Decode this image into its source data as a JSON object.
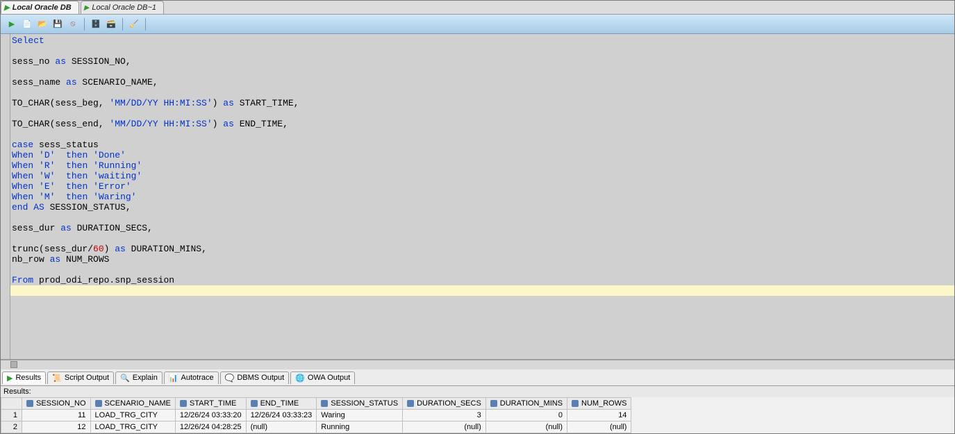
{
  "tabs": [
    {
      "label": "Local Oracle DB",
      "active": true
    },
    {
      "label": "Local Oracle DB~1",
      "active": false
    }
  ],
  "toolbar": {
    "run": "run",
    "new": "new",
    "open": "open",
    "save": "save",
    "cancel": "cancel",
    "commit": "commit",
    "rollback": "rollback",
    "clear": "clear"
  },
  "sql": {
    "lines": [
      {
        "t": "kw",
        "text": "Select"
      },
      {
        "t": "",
        "text": ""
      },
      {
        "t": "mixed",
        "parts": [
          [
            "",
            "sess_no "
          ],
          [
            "kw",
            "as"
          ],
          [
            "",
            " SESSION_NO,"
          ]
        ]
      },
      {
        "t": "",
        "text": ""
      },
      {
        "t": "mixed",
        "parts": [
          [
            "",
            "sess_name "
          ],
          [
            "kw",
            "as"
          ],
          [
            "",
            " SCENARIO_NAME,"
          ]
        ]
      },
      {
        "t": "",
        "text": ""
      },
      {
        "t": "mixed",
        "parts": [
          [
            "",
            "TO_CHAR(sess_beg, "
          ],
          [
            "str",
            "'MM/DD/YY HH:MI:SS'"
          ],
          [
            "",
            ") "
          ],
          [
            "kw",
            "as"
          ],
          [
            "",
            " START_TIME,"
          ]
        ]
      },
      {
        "t": "",
        "text": ""
      },
      {
        "t": "mixed",
        "parts": [
          [
            "",
            "TO_CHAR(sess_end, "
          ],
          [
            "str",
            "'MM/DD/YY HH:MI:SS'"
          ],
          [
            "",
            ") "
          ],
          [
            "kw",
            "as"
          ],
          [
            "",
            " END_TIME,"
          ]
        ]
      },
      {
        "t": "",
        "text": ""
      },
      {
        "t": "mixed",
        "parts": [
          [
            "kw",
            "case"
          ],
          [
            "",
            " sess_status"
          ]
        ]
      },
      {
        "t": "mixed",
        "parts": [
          [
            "kw",
            "When"
          ],
          [
            "",
            " "
          ],
          [
            "str",
            "'D'"
          ],
          [
            "",
            "  "
          ],
          [
            "kw",
            "then"
          ],
          [
            "",
            " "
          ],
          [
            "str",
            "'Done'"
          ]
        ]
      },
      {
        "t": "mixed",
        "parts": [
          [
            "kw",
            "When"
          ],
          [
            "",
            " "
          ],
          [
            "str",
            "'R'"
          ],
          [
            "",
            "  "
          ],
          [
            "kw",
            "then"
          ],
          [
            "",
            " "
          ],
          [
            "str",
            "'Running'"
          ]
        ]
      },
      {
        "t": "mixed",
        "parts": [
          [
            "kw",
            "When"
          ],
          [
            "",
            " "
          ],
          [
            "str",
            "'W'"
          ],
          [
            "",
            "  "
          ],
          [
            "kw",
            "then"
          ],
          [
            "",
            " "
          ],
          [
            "str",
            "'waiting'"
          ]
        ]
      },
      {
        "t": "mixed",
        "parts": [
          [
            "kw",
            "When"
          ],
          [
            "",
            " "
          ],
          [
            "str",
            "'E'"
          ],
          [
            "",
            "  "
          ],
          [
            "kw",
            "then"
          ],
          [
            "",
            " "
          ],
          [
            "str",
            "'Error'"
          ]
        ]
      },
      {
        "t": "mixed",
        "parts": [
          [
            "kw",
            "When"
          ],
          [
            "",
            " "
          ],
          [
            "str",
            "'M'"
          ],
          [
            "",
            "  "
          ],
          [
            "kw",
            "then"
          ],
          [
            "",
            " "
          ],
          [
            "str",
            "'Waring'"
          ]
        ]
      },
      {
        "t": "mixed",
        "parts": [
          [
            "kw",
            "end"
          ],
          [
            "",
            " "
          ],
          [
            "kw",
            "AS"
          ],
          [
            "",
            " SESSION_STATUS,"
          ]
        ]
      },
      {
        "t": "",
        "text": ""
      },
      {
        "t": "mixed",
        "parts": [
          [
            "",
            "sess_dur "
          ],
          [
            "kw",
            "as"
          ],
          [
            "",
            " DURATION_SECS,"
          ]
        ]
      },
      {
        "t": "",
        "text": ""
      },
      {
        "t": "mixed",
        "parts": [
          [
            "",
            "trunc(sess_dur/"
          ],
          [
            "lit",
            "60"
          ],
          [
            "",
            ") "
          ],
          [
            "kw",
            "as"
          ],
          [
            "",
            " DURATION_MINS,"
          ]
        ]
      },
      {
        "t": "mixed",
        "parts": [
          [
            "",
            "nb_row "
          ],
          [
            "kw",
            "as"
          ],
          [
            "",
            " NUM_ROWS"
          ]
        ]
      },
      {
        "t": "",
        "text": ""
      },
      {
        "t": "mixed",
        "parts": [
          [
            "kw",
            "From"
          ],
          [
            "",
            " prod_odi_repo.snp_session"
          ]
        ]
      },
      {
        "t": "hl",
        "text": ""
      }
    ]
  },
  "resultsTabs": [
    {
      "label": "Results",
      "active": true
    },
    {
      "label": "Script Output",
      "active": false
    },
    {
      "label": "Explain",
      "active": false
    },
    {
      "label": "Autotrace",
      "active": false
    },
    {
      "label": "DBMS Output",
      "active": false
    },
    {
      "label": "OWA Output",
      "active": false
    }
  ],
  "resultsLabel": "Results:",
  "grid": {
    "columns": [
      "SESSION_NO",
      "SCENARIO_NAME",
      "START_TIME",
      "END_TIME",
      "SESSION_STATUS",
      "DURATION_SECS",
      "DURATION_MINS",
      "NUM_ROWS"
    ],
    "alignNumeric": [
      true,
      false,
      false,
      false,
      false,
      true,
      true,
      true
    ],
    "rows": [
      {
        "n": 1,
        "cells": [
          "11",
          "LOAD_TRG_CITY",
          "12/26/24 03:33:20",
          "12/26/24 03:33:23",
          "Waring",
          "3",
          "0",
          "14"
        ]
      },
      {
        "n": 2,
        "cells": [
          "12",
          "LOAD_TRG_CITY",
          "12/26/24 04:28:25",
          "(null)",
          "Running",
          "(null)",
          "(null)",
          "(null)"
        ]
      }
    ]
  }
}
